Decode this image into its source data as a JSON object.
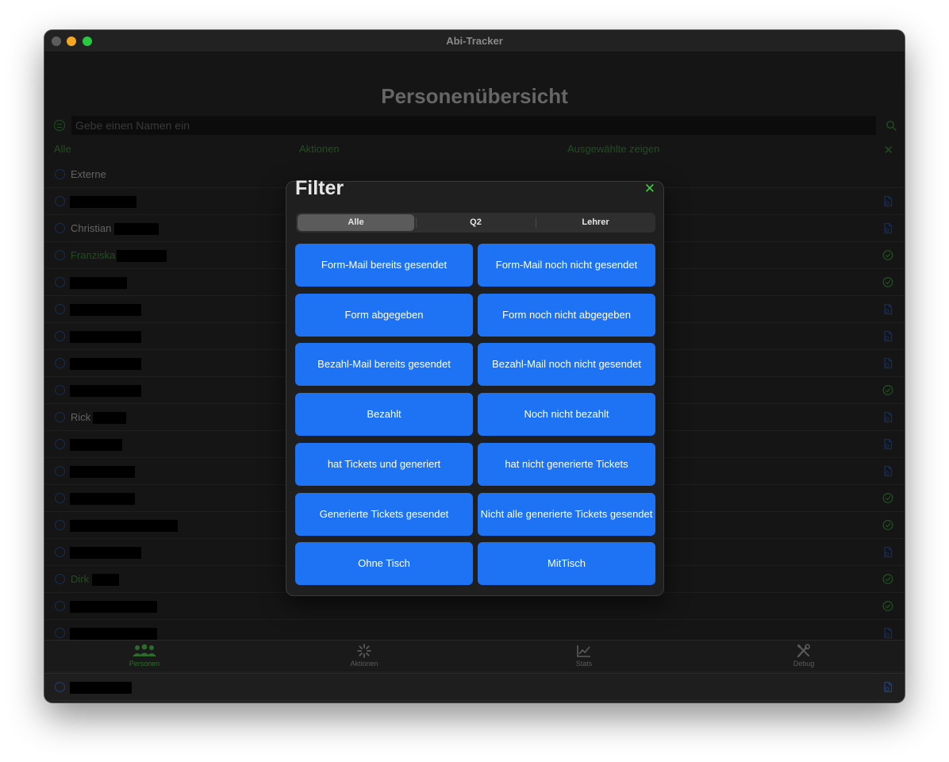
{
  "window": {
    "title": "Abi-Tracker"
  },
  "page": {
    "title": "Personenübersicht"
  },
  "search": {
    "placeholder": "Gebe einen Namen ein"
  },
  "actions": {
    "all": "Alle",
    "actions": "Aktionen",
    "show_selected": "Ausgewählte zeigen"
  },
  "people": [
    {
      "name": "Externe",
      "status": ""
    },
    {
      "name": "",
      "status": "document"
    },
    {
      "name": "Christian",
      "status": "document"
    },
    {
      "name": "Franziska",
      "status": "check",
      "highlight": true
    },
    {
      "name": "",
      "status": "check"
    },
    {
      "name": "",
      "status": "document"
    },
    {
      "name": "",
      "status": "document"
    },
    {
      "name": "",
      "status": "document"
    },
    {
      "name": "",
      "status": "check"
    },
    {
      "name": "Rick",
      "status": "document"
    },
    {
      "name": "",
      "status": "document"
    },
    {
      "name": "",
      "status": "document"
    },
    {
      "name": "",
      "status": "check"
    },
    {
      "name": "",
      "status": "check"
    },
    {
      "name": "",
      "status": "document"
    },
    {
      "name": "Dirk",
      "status": "check",
      "highlight": true
    },
    {
      "name": "",
      "status": "check"
    },
    {
      "name": "",
      "status": "document"
    },
    {
      "name": "",
      "status": "document"
    },
    {
      "name": "",
      "status": "document"
    }
  ],
  "tabbar": {
    "items": [
      {
        "label": "Personen",
        "active": true
      },
      {
        "label": "Aktionen",
        "active": false
      },
      {
        "label": "Stats",
        "active": false
      },
      {
        "label": "Debug",
        "active": false
      }
    ]
  },
  "filter_modal": {
    "title": "Filter",
    "segments": [
      "Alle",
      "Q2",
      "Lehrer"
    ],
    "selected_segment": "Alle",
    "buttons": [
      "Form-Mail bereits gesendet",
      "Form-Mail noch nicht gesendet",
      "Form abgegeben",
      "Form noch nicht abgegeben",
      "Bezahl-Mail bereits gesendet",
      "Bezahl-Mail noch nicht gesendet",
      "Bezahlt",
      "Noch nicht bezahlt",
      "hat Tickets und generiert",
      "hat nicht generierte Tickets",
      "Generierte Tickets gesendet",
      "Nicht alle generierte Tickets gesendet",
      "Ohne Tisch",
      "MitTisch"
    ]
  },
  "colors": {
    "accent_green": "#2d6b2d",
    "accent_blue": "#1e73f5",
    "background": "#1e1e1e"
  }
}
